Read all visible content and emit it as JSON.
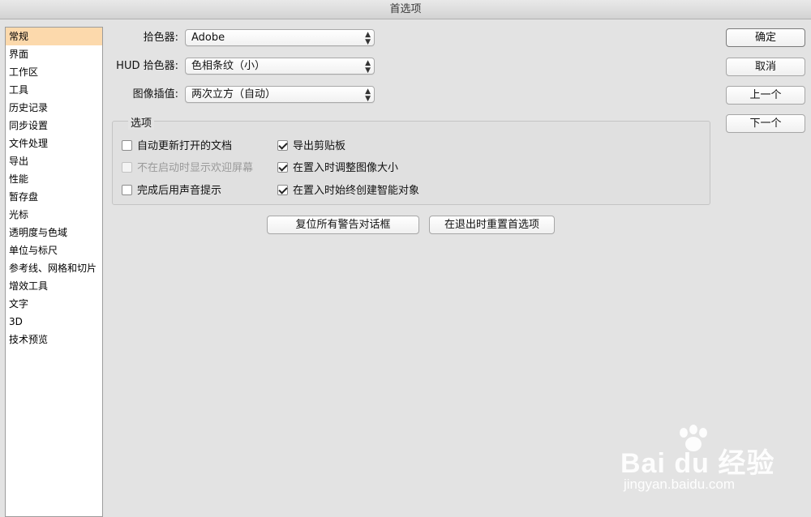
{
  "window": {
    "title": "首选项"
  },
  "sidebar": {
    "items": [
      {
        "label": "常规",
        "selected": true
      },
      {
        "label": "界面"
      },
      {
        "label": "工作区"
      },
      {
        "label": "工具"
      },
      {
        "label": "历史记录"
      },
      {
        "label": "同步设置"
      },
      {
        "label": "文件处理"
      },
      {
        "label": "导出"
      },
      {
        "label": "性能"
      },
      {
        "label": "暂存盘"
      },
      {
        "label": "光标"
      },
      {
        "label": "透明度与色域"
      },
      {
        "label": "单位与标尺"
      },
      {
        "label": "参考线、网格和切片"
      },
      {
        "label": "增效工具"
      },
      {
        "label": "文字"
      },
      {
        "label": "3D"
      },
      {
        "label": "技术预览"
      }
    ]
  },
  "fields": {
    "color_picker": {
      "label": "拾色器:",
      "value": "Adobe"
    },
    "hud_color_picker": {
      "label": "HUD 拾色器:",
      "value": "色相条纹（小）"
    },
    "image_interpolation": {
      "label": "图像插值:",
      "value": "两次立方（自动）"
    }
  },
  "options": {
    "title": "选项",
    "auto_update_docs": {
      "label": "自动更新打开的文档",
      "checked": false
    },
    "hide_welcome": {
      "label": "不在启动时显示欢迎屏幕",
      "checked": false,
      "disabled": true
    },
    "beep_when_done": {
      "label": "完成后用声音提示",
      "checked": false
    },
    "export_clipboard": {
      "label": "导出剪贴板",
      "checked": true
    },
    "resize_on_place": {
      "label": "在置入时调整图像大小",
      "checked": true
    },
    "smart_object_on_place": {
      "label": "在置入时始终创建智能对象",
      "checked": true
    }
  },
  "buttons": {
    "ok": "确定",
    "cancel": "取消",
    "prev": "上一个",
    "next": "下一个",
    "reset_warnings": "复位所有警告对话框",
    "reset_prefs": "在退出时重置首选项"
  },
  "watermark": {
    "brand": "Bai du 经验",
    "url": "jingyan.baidu.com"
  }
}
